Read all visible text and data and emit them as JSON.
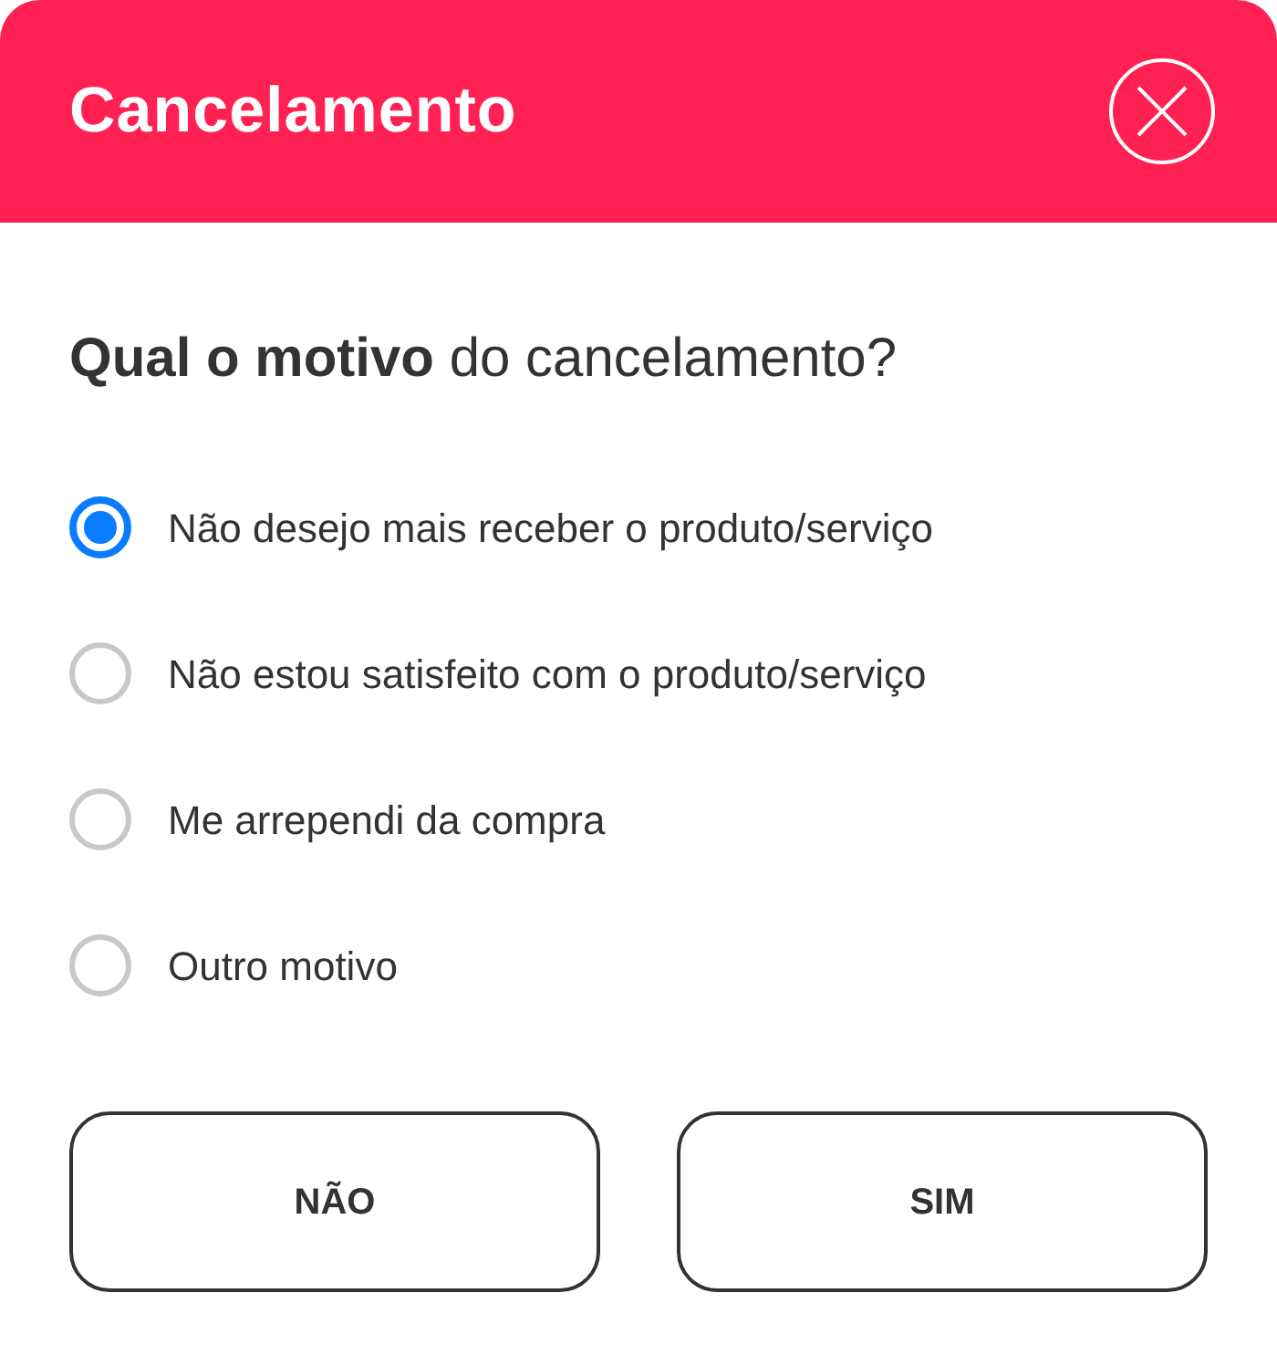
{
  "dialog": {
    "title": "Cancelamento"
  },
  "question": "**Qual o motivo** do cancelamento?",
  "options": [
    {
      "label": "Não desejo mais receber o produto/serviço",
      "selected": true
    },
    {
      "label": "Não estou satisfeito com o produto/serviço",
      "selected": false
    },
    {
      "label": "Me arrependi da compra",
      "selected": false
    },
    {
      "label": "Outro motivo",
      "selected": false
    }
  ],
  "buttons": [
    "NÃO",
    "SIM"
  ]
}
